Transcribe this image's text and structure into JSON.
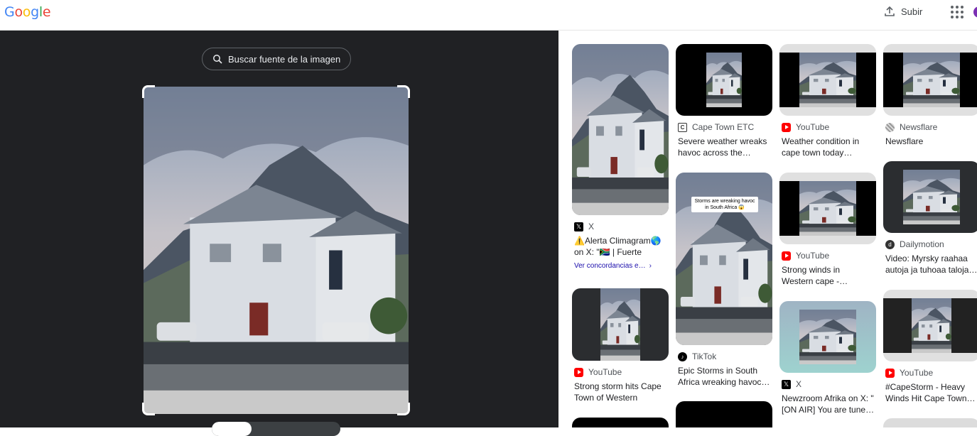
{
  "header": {
    "logo": "Google",
    "upload_label": "Subir",
    "apps_icon": "apps-grid-icon"
  },
  "viewer": {
    "source_button_label": "Buscar fuente de la imagen",
    "source_icon": "lens-search-icon"
  },
  "results": [
    {
      "source": "X",
      "title_line1": "⚠️Alerta Climagram🌎",
      "title_line2": "on X: \"🇿🇦 | Fuerte vient…",
      "more": "Ver concordancias e…",
      "icon": "x-logo-icon"
    },
    {
      "source": "Cape Town ETC",
      "title_line1": "Severe weather wreaks",
      "title_line2": "havoc across the…",
      "icon": "cape-town-etc-icon"
    },
    {
      "source": "YouTube",
      "title_line1": "Weather condition in",
      "title_line2": "cape town today…",
      "icon": "youtube-icon"
    },
    {
      "source": "Newsflare",
      "title_line1": "Newsflare",
      "title_line2": "",
      "icon": "newsflare-icon"
    },
    {
      "source": "TikTok",
      "title_line1": "Epic Storms in South",
      "title_line2": "Africa wreaking havoc…",
      "icon": "tiktok-icon",
      "overlay": "Storms are wreaking havoc in South Africa 😱"
    },
    {
      "source": "YouTube",
      "title_line1": "Strong winds in",
      "title_line2": "Western cape -…",
      "icon": "youtube-icon"
    },
    {
      "source": "Dailymotion",
      "title_line1": "Video: Myrsky raahaa",
      "title_line2": "autoja ja tuhoaa taloja…",
      "icon": "dailymotion-icon"
    },
    {
      "source": "YouTube",
      "title_line1": "Strong storm hits Cape",
      "title_line2": "Town of Western Cape…",
      "icon": "youtube-icon"
    },
    {
      "source": "X",
      "title_line1": "Newzroom Afrika on X: \"",
      "title_line2": "[ON AIR] You are tune…",
      "icon": "x-logo-icon"
    },
    {
      "source": "YouTube",
      "title_line1": "#CapeStorm - Heavy",
      "title_line2": "Winds Hit Cape Town…",
      "icon": "youtube-icon"
    }
  ]
}
